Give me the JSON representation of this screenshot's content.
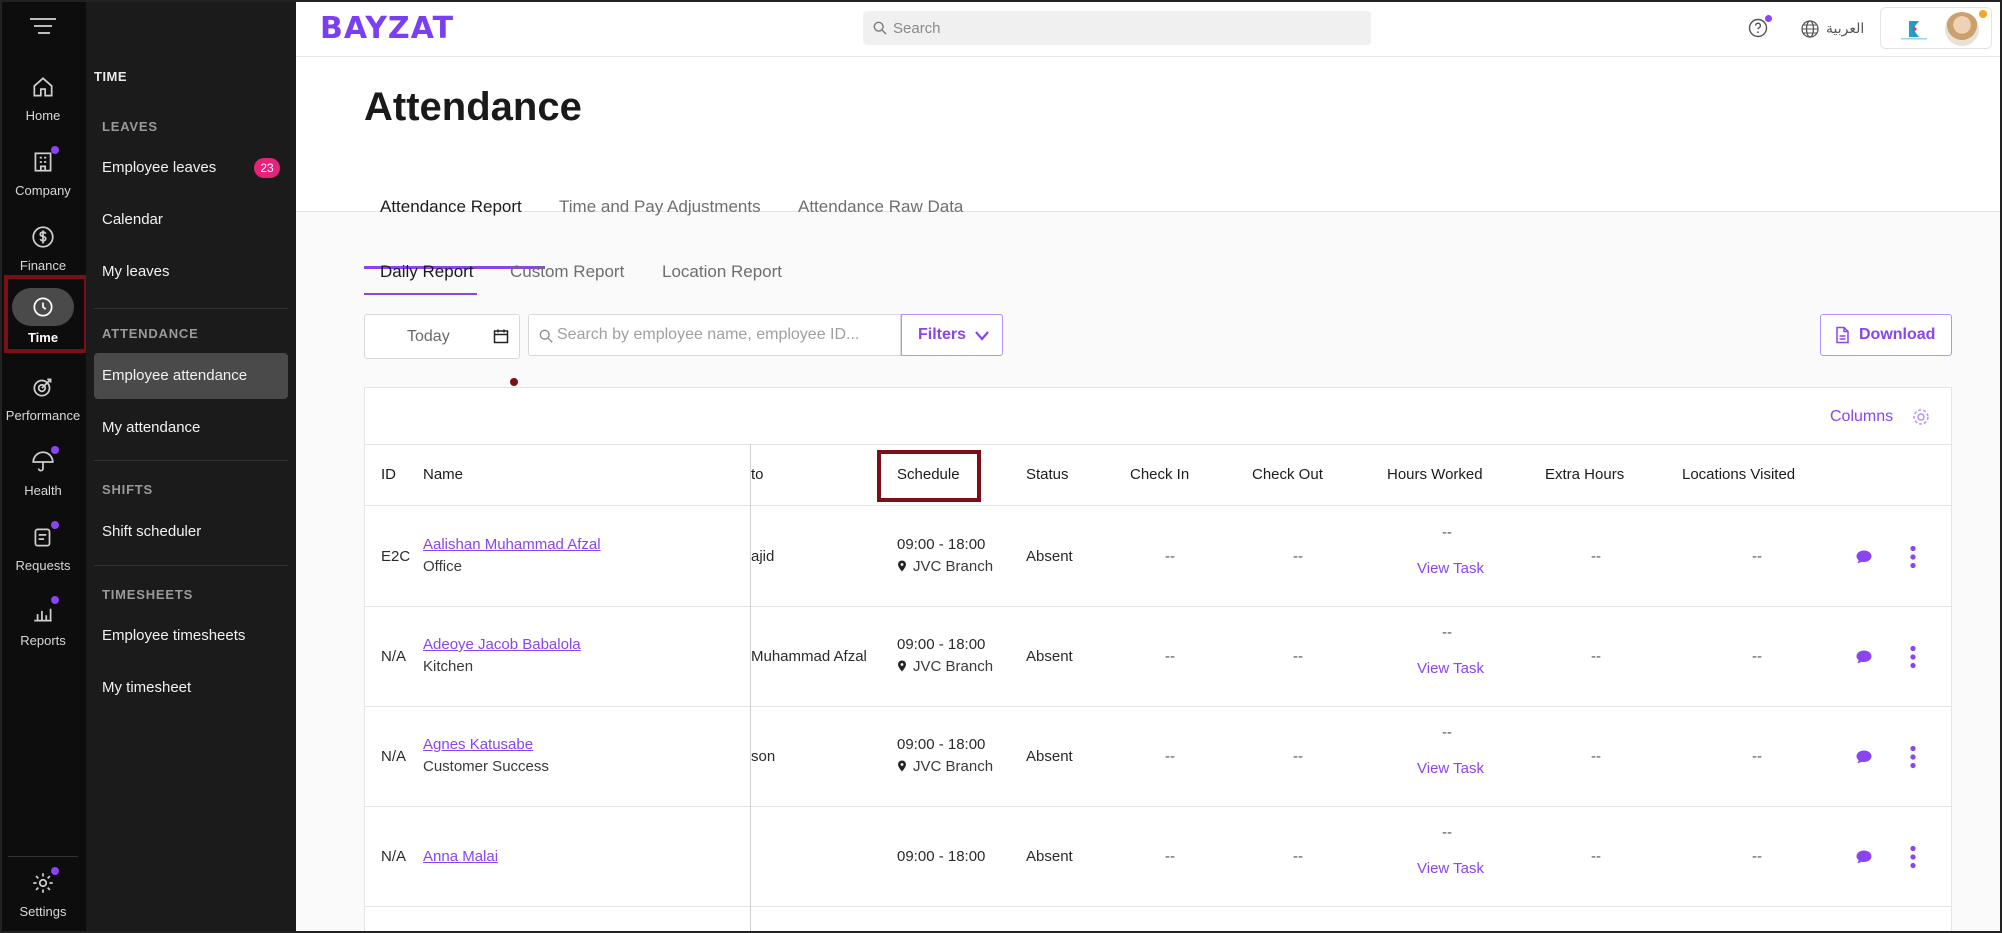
{
  "colors": {
    "accent": "#8a44f2",
    "badge": "#e3247a",
    "highlight": "#7a0f1a",
    "rail_bg": "#0d0d0d",
    "subnav_bg": "#1b1b1b"
  },
  "rail": {
    "items": [
      {
        "label": "Home",
        "icon": "home-icon"
      },
      {
        "label": "Company",
        "icon": "building-icon"
      },
      {
        "label": "Finance",
        "icon": "dollar-icon"
      },
      {
        "label": "Time",
        "icon": "clock-icon"
      },
      {
        "label": "Performance",
        "icon": "target-icon"
      },
      {
        "label": "Health",
        "icon": "umbrella-icon"
      },
      {
        "label": "Requests",
        "icon": "request-icon"
      },
      {
        "label": "Reports",
        "icon": "chart-icon"
      },
      {
        "label": "Settings",
        "icon": "gear-icon"
      }
    ]
  },
  "subnav": {
    "title": "TIME",
    "leaves_label": "LEAVES",
    "employee_leaves": "Employee leaves",
    "employee_leaves_badge": "23",
    "calendar": "Calendar",
    "my_leaves": "My leaves",
    "attendance_label": "ATTENDANCE",
    "employee_attendance": "Employee attendance",
    "my_attendance": "My attendance",
    "shifts_label": "SHIFTS",
    "shift_scheduler": "Shift scheduler",
    "timesheets_label": "TIMESHEETS",
    "employee_timesheets": "Employee timesheets",
    "my_timesheet": "My timesheet"
  },
  "header": {
    "logo": "BAYZAT",
    "search_placeholder": "Search",
    "language": "العربية"
  },
  "page": {
    "title": "Attendance",
    "tabs": [
      "Attendance Report",
      "Time and Pay Adjustments",
      "Attendance Raw Data"
    ],
    "subtabs": [
      "Daily Report",
      "Custom Report",
      "Location Report"
    ],
    "date": "Today",
    "employee_search_placeholder": "Search by employee name, employee ID...",
    "filters": "Filters",
    "download": "Download",
    "columns": "Columns"
  },
  "table": {
    "headers": {
      "id": "ID",
      "name": "Name",
      "reports_to": "to",
      "schedule": "Schedule",
      "status": "Status",
      "check_in": "Check In",
      "check_out": "Check Out",
      "hours_worked": "Hours Worked",
      "extra_hours": "Extra Hours",
      "locations": "Locations Visited"
    },
    "rows": [
      {
        "id": "E2C",
        "name": "Aalishan Muhammad Afzal",
        "dept": "Office",
        "reports_to": "ajid",
        "schedule": "09:00 - 18:00",
        "location": "JVC Branch",
        "status": "Absent",
        "check_in": "--",
        "check_out": "--",
        "hours": "--",
        "view_task": "View Task",
        "extra": "--",
        "locations": "--"
      },
      {
        "id": "N/A",
        "name": "Adeoye Jacob Babalola",
        "dept": "Kitchen",
        "reports_to": "Muhammad Afzal",
        "schedule": "09:00 - 18:00",
        "location": "JVC Branch",
        "status": "Absent",
        "check_in": "--",
        "check_out": "--",
        "hours": "--",
        "view_task": "View Task",
        "extra": "--",
        "locations": "--"
      },
      {
        "id": "N/A",
        "name": "Agnes Katusabe",
        "dept": "Customer Success",
        "reports_to": "son",
        "schedule": "09:00 - 18:00",
        "location": "JVC Branch",
        "status": "Absent",
        "check_in": "--",
        "check_out": "--",
        "hours": "--",
        "view_task": "View Task",
        "extra": "--",
        "locations": "--"
      },
      {
        "id": "N/A",
        "name": "Anna Malai",
        "dept": "",
        "reports_to": "",
        "schedule": "09:00 - 18:00",
        "location": "",
        "status": "Absent",
        "check_in": "--",
        "check_out": "--",
        "hours": "--",
        "view_task": "View Task",
        "extra": "--",
        "locations": "--"
      }
    ]
  }
}
